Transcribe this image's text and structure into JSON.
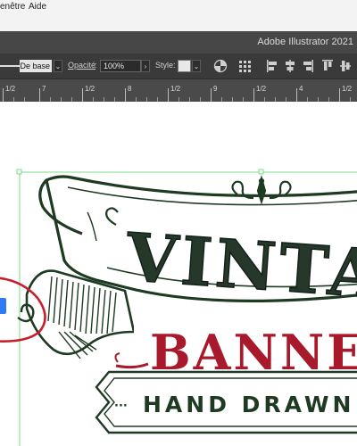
{
  "menubar": {
    "items": [
      "enêtre",
      "Aide"
    ]
  },
  "titlebar": {
    "app_title": "Adobe Illustrator 2021"
  },
  "toolbar": {
    "stroke_profile": "De base",
    "opacity_label": "Opacité",
    "opacity_value": "100%",
    "style_label": "Style"
  },
  "ruler": {
    "labels": [
      "1/2",
      "7",
      "1/2",
      "8",
      "1/2",
      "9",
      "1/2",
      "4",
      "1/2"
    ]
  },
  "artwork": {
    "line1": "VINTAGE",
    "line2": "BANNER",
    "line3": "HAND DRAWN",
    "ink_color": "#1f3a22",
    "accent_color": "#a8192b"
  },
  "annotation": {
    "color": "#c81e2b"
  },
  "selection": {
    "color": "#5ed46a"
  }
}
